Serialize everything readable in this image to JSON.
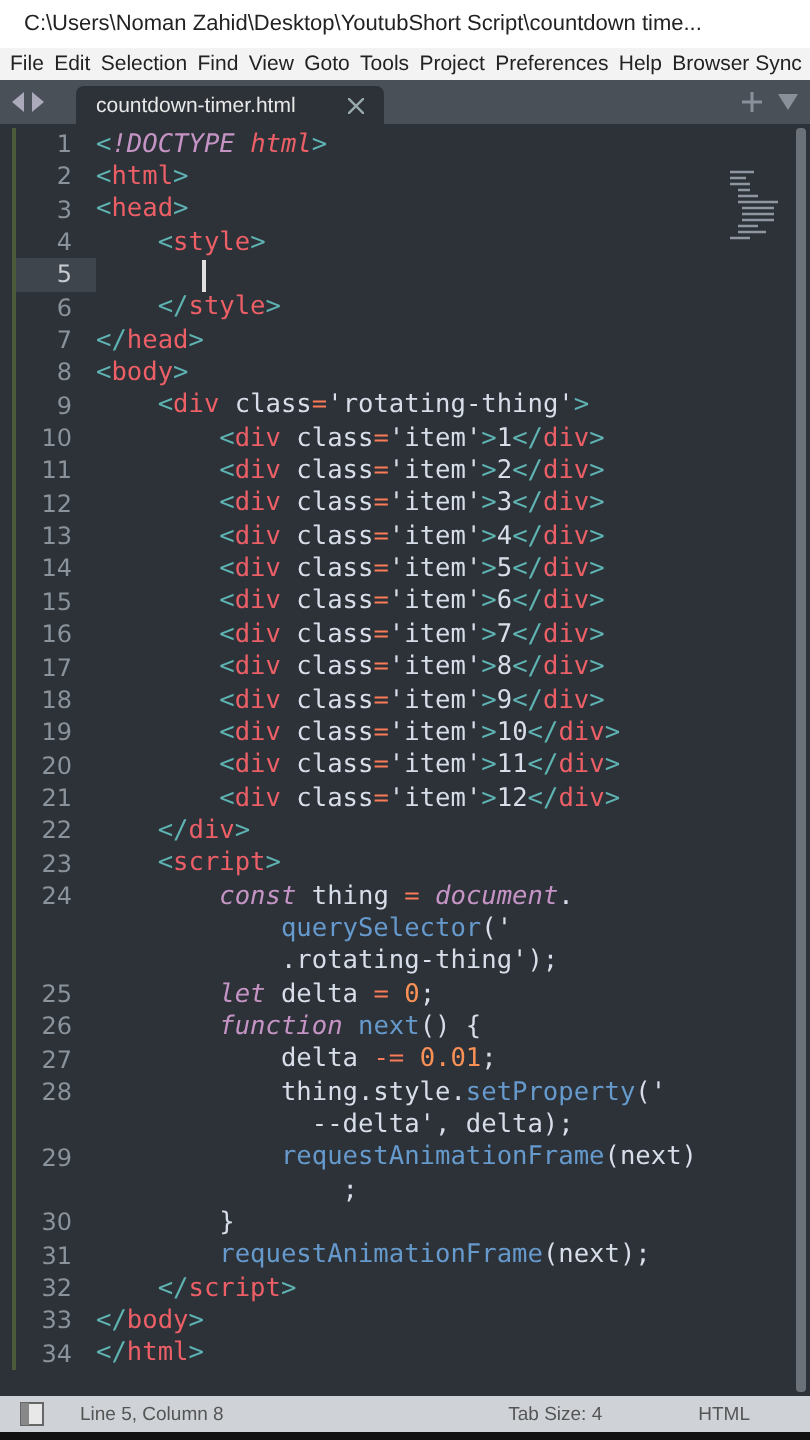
{
  "window": {
    "title": "C:\\Users\\Noman Zahid\\Desktop\\YoutubShort Script\\countdown time..."
  },
  "menu": [
    "File",
    "Edit",
    "Selection",
    "Find",
    "View",
    "Goto",
    "Tools",
    "Project",
    "Preferences",
    "Help",
    "Browser Sync"
  ],
  "tabs": [
    {
      "label": "countdown-timer.html",
      "selected": true
    }
  ],
  "lines": [
    {
      "number": "1",
      "current": false,
      "tokens": [
        {
          "text": "<",
          "kind": "punct"
        },
        {
          "text": "!DOCTYPE ",
          "kind": "doctype"
        },
        {
          "text": "html",
          "kind": "doctype-name"
        },
        {
          "text": ">",
          "kind": "punct"
        }
      ]
    },
    {
      "number": "2",
      "current": false,
      "tokens": [
        {
          "text": "<",
          "kind": "punct"
        },
        {
          "text": "html",
          "kind": "tag"
        },
        {
          "text": ">",
          "kind": "punct"
        }
      ]
    },
    {
      "number": "3",
      "current": false,
      "tokens": [
        {
          "text": "<",
          "kind": "punct"
        },
        {
          "text": "head",
          "kind": "tag"
        },
        {
          "text": ">",
          "kind": "punct"
        }
      ]
    },
    {
      "number": "4",
      "current": false,
      "tokens": [
        {
          "text": "    <",
          "kind": "punct"
        },
        {
          "text": "style",
          "kind": "tag"
        },
        {
          "text": ">",
          "kind": "punct"
        }
      ]
    },
    {
      "number": "5",
      "current": true
    },
    {
      "number": "6",
      "current": false,
      "tokens": [
        {
          "text": "    </",
          "kind": "punct"
        },
        {
          "text": "style",
          "kind": "tag"
        },
        {
          "text": ">",
          "kind": "punct"
        }
      ]
    },
    {
      "number": "7",
      "current": false,
      "tokens": [
        {
          "text": "</",
          "kind": "punct"
        },
        {
          "text": "head",
          "kind": "tag"
        },
        {
          "text": ">",
          "kind": "punct"
        }
      ]
    },
    {
      "number": "8",
      "current": false,
      "tokens": [
        {
          "text": "<",
          "kind": "punct"
        },
        {
          "text": "body",
          "kind": "tag"
        },
        {
          "text": ">",
          "kind": "punct"
        }
      ]
    },
    {
      "number": "9",
      "current": false,
      "tokens": [
        {
          "text": "    <",
          "kind": "punct"
        },
        {
          "text": "div",
          "kind": "tag"
        },
        {
          "text": " class",
          "kind": "attr"
        },
        {
          "text": "=",
          "kind": "op"
        },
        {
          "text": "'rotating-thing'",
          "kind": "string"
        },
        {
          "text": ">",
          "kind": "punct"
        }
      ]
    },
    {
      "number": "10",
      "current": false,
      "tokens": [
        {
          "text": "        <",
          "kind": "punct"
        },
        {
          "text": "div",
          "kind": "tag"
        },
        {
          "text": " class",
          "kind": "attr"
        },
        {
          "text": "=",
          "kind": "op"
        },
        {
          "text": "'item'",
          "kind": "string"
        },
        {
          "text": ">",
          "kind": "punct"
        },
        {
          "text": "1",
          "kind": "text"
        },
        {
          "text": "</",
          "kind": "punct"
        },
        {
          "text": "div",
          "kind": "tag"
        },
        {
          "text": ">",
          "kind": "punct"
        }
      ]
    },
    {
      "number": "11",
      "current": false,
      "tokens": [
        {
          "text": "        <",
          "kind": "punct"
        },
        {
          "text": "div",
          "kind": "tag"
        },
        {
          "text": " class",
          "kind": "attr"
        },
        {
          "text": "=",
          "kind": "op"
        },
        {
          "text": "'item'",
          "kind": "string"
        },
        {
          "text": ">",
          "kind": "punct"
        },
        {
          "text": "2",
          "kind": "text"
        },
        {
          "text": "</",
          "kind": "punct"
        },
        {
          "text": "div",
          "kind": "tag"
        },
        {
          "text": ">",
          "kind": "punct"
        }
      ]
    },
    {
      "number": "12",
      "current": false,
      "tokens": [
        {
          "text": "        <",
          "kind": "punct"
        },
        {
          "text": "div",
          "kind": "tag"
        },
        {
          "text": " class",
          "kind": "attr"
        },
        {
          "text": "=",
          "kind": "op"
        },
        {
          "text": "'item'",
          "kind": "string"
        },
        {
          "text": ">",
          "kind": "punct"
        },
        {
          "text": "3",
          "kind": "text"
        },
        {
          "text": "</",
          "kind": "punct"
        },
        {
          "text": "div",
          "kind": "tag"
        },
        {
          "text": ">",
          "kind": "punct"
        }
      ]
    },
    {
      "number": "13",
      "current": false,
      "tokens": [
        {
          "text": "        <",
          "kind": "punct"
        },
        {
          "text": "div",
          "kind": "tag"
        },
        {
          "text": " class",
          "kind": "attr"
        },
        {
          "text": "=",
          "kind": "op"
        },
        {
          "text": "'item'",
          "kind": "string"
        },
        {
          "text": ">",
          "kind": "punct"
        },
        {
          "text": "4",
          "kind": "text"
        },
        {
          "text": "</",
          "kind": "punct"
        },
        {
          "text": "div",
          "kind": "tag"
        },
        {
          "text": ">",
          "kind": "punct"
        }
      ]
    },
    {
      "number": "14",
      "current": false,
      "tokens": [
        {
          "text": "        <",
          "kind": "punct"
        },
        {
          "text": "div",
          "kind": "tag"
        },
        {
          "text": " class",
          "kind": "attr"
        },
        {
          "text": "=",
          "kind": "op"
        },
        {
          "text": "'item'",
          "kind": "string"
        },
        {
          "text": ">",
          "kind": "punct"
        },
        {
          "text": "5",
          "kind": "text"
        },
        {
          "text": "</",
          "kind": "punct"
        },
        {
          "text": "div",
          "kind": "tag"
        },
        {
          "text": ">",
          "kind": "punct"
        }
      ]
    },
    {
      "number": "15",
      "current": false,
      "tokens": [
        {
          "text": "        <",
          "kind": "punct"
        },
        {
          "text": "div",
          "kind": "tag"
        },
        {
          "text": " class",
          "kind": "attr"
        },
        {
          "text": "=",
          "kind": "op"
        },
        {
          "text": "'item'",
          "kind": "string"
        },
        {
          "text": ">",
          "kind": "punct"
        },
        {
          "text": "6",
          "kind": "text"
        },
        {
          "text": "</",
          "kind": "punct"
        },
        {
          "text": "div",
          "kind": "tag"
        },
        {
          "text": ">",
          "kind": "punct"
        }
      ]
    },
    {
      "number": "16",
      "current": false,
      "tokens": [
        {
          "text": "        <",
          "kind": "punct"
        },
        {
          "text": "div",
          "kind": "tag"
        },
        {
          "text": " class",
          "kind": "attr"
        },
        {
          "text": "=",
          "kind": "op"
        },
        {
          "text": "'item'",
          "kind": "string"
        },
        {
          "text": ">",
          "kind": "punct"
        },
        {
          "text": "7",
          "kind": "text"
        },
        {
          "text": "</",
          "kind": "punct"
        },
        {
          "text": "div",
          "kind": "tag"
        },
        {
          "text": ">",
          "kind": "punct"
        }
      ]
    },
    {
      "number": "17",
      "current": false,
      "tokens": [
        {
          "text": "        <",
          "kind": "punct"
        },
        {
          "text": "div",
          "kind": "tag"
        },
        {
          "text": " class",
          "kind": "attr"
        },
        {
          "text": "=",
          "kind": "op"
        },
        {
          "text": "'item'",
          "kind": "string"
        },
        {
          "text": ">",
          "kind": "punct"
        },
        {
          "text": "8",
          "kind": "text"
        },
        {
          "text": "</",
          "kind": "punct"
        },
        {
          "text": "div",
          "kind": "tag"
        },
        {
          "text": ">",
          "kind": "punct"
        }
      ]
    },
    {
      "number": "18",
      "current": false,
      "tokens": [
        {
          "text": "        <",
          "kind": "punct"
        },
        {
          "text": "div",
          "kind": "tag"
        },
        {
          "text": " class",
          "kind": "attr"
        },
        {
          "text": "=",
          "kind": "op"
        },
        {
          "text": "'item'",
          "kind": "string"
        },
        {
          "text": ">",
          "kind": "punct"
        },
        {
          "text": "9",
          "kind": "text"
        },
        {
          "text": "</",
          "kind": "punct"
        },
        {
          "text": "div",
          "kind": "tag"
        },
        {
          "text": ">",
          "kind": "punct"
        }
      ]
    },
    {
      "number": "19",
      "current": false,
      "tokens": [
        {
          "text": "        <",
          "kind": "punct"
        },
        {
          "text": "div",
          "kind": "tag"
        },
        {
          "text": " class",
          "kind": "attr"
        },
        {
          "text": "=",
          "kind": "op"
        },
        {
          "text": "'item'",
          "kind": "string"
        },
        {
          "text": ">",
          "kind": "punct"
        },
        {
          "text": "10",
          "kind": "text"
        },
        {
          "text": "</",
          "kind": "punct"
        },
        {
          "text": "div",
          "kind": "tag"
        },
        {
          "text": ">",
          "kind": "punct"
        }
      ]
    },
    {
      "number": "20",
      "current": false,
      "tokens": [
        {
          "text": "        <",
          "kind": "punct"
        },
        {
          "text": "div",
          "kind": "tag"
        },
        {
          "text": " class",
          "kind": "attr"
        },
        {
          "text": "=",
          "kind": "op"
        },
        {
          "text": "'item'",
          "kind": "string"
        },
        {
          "text": ">",
          "kind": "punct"
        },
        {
          "text": "11",
          "kind": "text"
        },
        {
          "text": "</",
          "kind": "punct"
        },
        {
          "text": "div",
          "kind": "tag"
        },
        {
          "text": ">",
          "kind": "punct"
        }
      ]
    },
    {
      "number": "21",
      "current": false,
      "tokens": [
        {
          "text": "        <",
          "kind": "punct"
        },
        {
          "text": "div",
          "kind": "tag"
        },
        {
          "text": " class",
          "kind": "attr"
        },
        {
          "text": "=",
          "kind": "op"
        },
        {
          "text": "'item'",
          "kind": "string"
        },
        {
          "text": ">",
          "kind": "punct"
        },
        {
          "text": "12",
          "kind": "text"
        },
        {
          "text": "</",
          "kind": "punct"
        },
        {
          "text": "div",
          "kind": "tag"
        },
        {
          "text": ">",
          "kind": "punct"
        }
      ]
    },
    {
      "number": "22",
      "current": false,
      "tokens": [
        {
          "text": "    </",
          "kind": "punct"
        },
        {
          "text": "div",
          "kind": "tag"
        },
        {
          "text": ">",
          "kind": "punct"
        }
      ]
    },
    {
      "number": "23",
      "current": false,
      "tokens": [
        {
          "text": "    <",
          "kind": "punct"
        },
        {
          "text": "script",
          "kind": "tag"
        },
        {
          "text": ">",
          "kind": "punct"
        }
      ]
    },
    {
      "number": "24",
      "current": false,
      "tokens": [
        {
          "text": "        const",
          "kind": "keyword"
        },
        {
          "text": " thing ",
          "kind": "text"
        },
        {
          "text": "=",
          "kind": "op"
        },
        {
          "text": " document",
          "kind": "builtin"
        },
        {
          "text": ".",
          "kind": "text"
        }
      ],
      "wrapped": [
        {
          "tokens": [
            {
              "text": "            querySelector",
              "kind": "func"
            },
            {
              "text": "('",
              "kind": "text"
            }
          ]
        },
        {
          "tokens": [
            {
              "text": "            .rotating-thing');",
              "kind": "text"
            }
          ]
        }
      ]
    },
    {
      "number": "25",
      "current": false,
      "tokens": [
        {
          "text": "        let",
          "kind": "keyword"
        },
        {
          "text": " delta ",
          "kind": "text"
        },
        {
          "text": "=",
          "kind": "op"
        },
        {
          "text": " 0",
          "kind": "number"
        },
        {
          "text": ";",
          "kind": "text"
        }
      ]
    },
    {
      "number": "26",
      "current": false,
      "tokens": [
        {
          "text": "        function",
          "kind": "keyword"
        },
        {
          "text": " next",
          "kind": "func"
        },
        {
          "text": "() {",
          "kind": "text"
        }
      ]
    },
    {
      "number": "27",
      "current": false,
      "tokens": [
        {
          "text": "            delta ",
          "kind": "text"
        },
        {
          "text": "-=",
          "kind": "op"
        },
        {
          "text": " 0.01",
          "kind": "number"
        },
        {
          "text": ";",
          "kind": "text"
        }
      ]
    },
    {
      "number": "28",
      "current": false,
      "tokens": [
        {
          "text": "            thing.style.",
          "kind": "text"
        },
        {
          "text": "setProperty",
          "kind": "func"
        },
        {
          "text": "('",
          "kind": "text"
        }
      ],
      "wrapped": [
        {
          "tokens": [
            {
              "text": "              --delta', delta);",
              "kind": "text"
            }
          ]
        }
      ]
    },
    {
      "number": "29",
      "current": false,
      "tokens": [
        {
          "text": "            requestAnimationFrame",
          "kind": "func"
        },
        {
          "text": "(next)",
          "kind": "text"
        }
      ],
      "wrapped": [
        {
          "tokens": [
            {
              "text": "                ;",
              "kind": "text"
            }
          ]
        }
      ]
    },
    {
      "number": "30",
      "current": false,
      "tokens": [
        {
          "text": "        }",
          "kind": "text"
        }
      ]
    },
    {
      "number": "31",
      "current": false,
      "tokens": [
        {
          "text": "        requestAnimationFrame",
          "kind": "func"
        },
        {
          "text": "(next);",
          "kind": "text"
        }
      ]
    },
    {
      "number": "32",
      "current": false,
      "tokens": [
        {
          "text": "    </",
          "kind": "punct"
        },
        {
          "text": "script",
          "kind": "tag"
        },
        {
          "text": ">",
          "kind": "punct"
        }
      ]
    },
    {
      "number": "33",
      "current": false,
      "tokens": [
        {
          "text": "</",
          "kind": "punct"
        },
        {
          "text": "body",
          "kind": "tag"
        },
        {
          "text": ">",
          "kind": "punct"
        }
      ]
    },
    {
      "number": "34",
      "current": false,
      "tokens": [
        {
          "text": "</",
          "kind": "punct"
        },
        {
          "text": "html",
          "kind": "tag"
        },
        {
          "text": ">",
          "kind": "punct"
        }
      ]
    }
  ],
  "status_bar": {
    "position": "Line 5, Column 8",
    "tab_size": "Tab Size: 4",
    "syntax": "HTML"
  }
}
